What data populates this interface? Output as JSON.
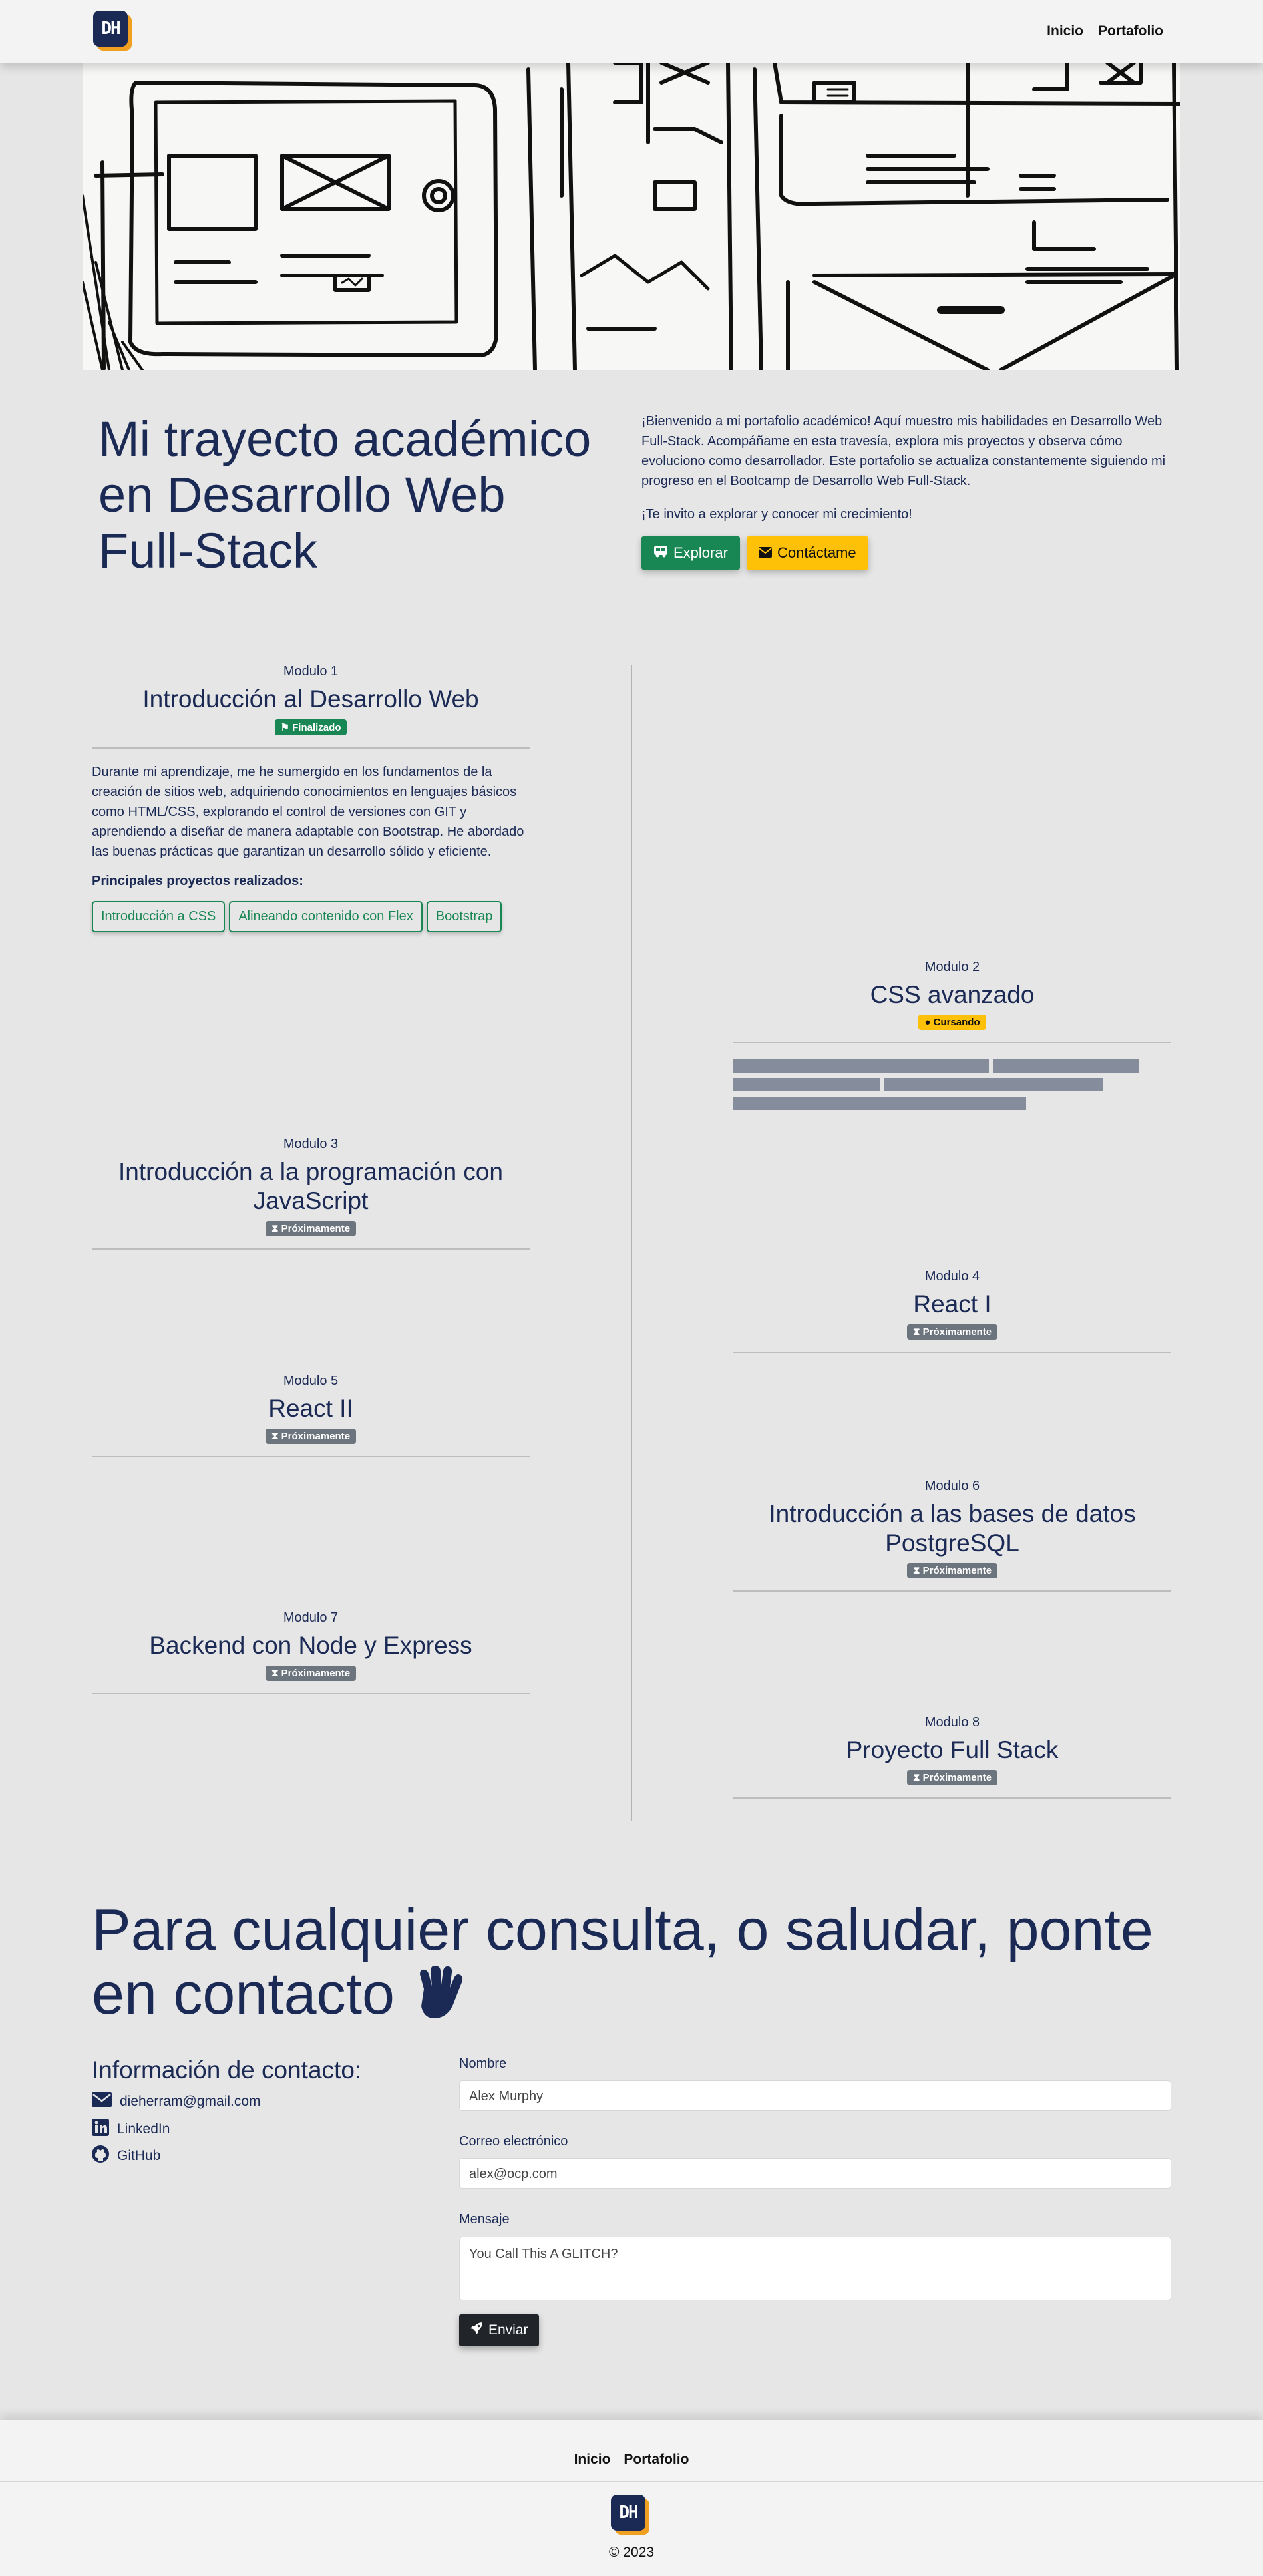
{
  "brand": {
    "logo_text": "DH"
  },
  "nav": {
    "items": [
      "Inicio",
      "Portafolio"
    ]
  },
  "intro": {
    "title": "Mi trayecto académico en Desarrollo Web Full-Stack",
    "paragraph1": "¡Bienvenido a mi portafolio académico! Aquí muestro mis habilidades en Desarrollo Web Full-Stack. Acompáñame en esta travesía, explora mis proyectos y observa cómo evoluciono como desarrollador. Este portafolio se actualiza constantemente siguiendo mi progreso en el Bootcamp de Desarrollo Web Full-Stack.",
    "paragraph2": "¡Te invito a explorar y conocer mi crecimiento!",
    "explore_label": "Explorar",
    "contact_label": "Contáctame"
  },
  "modules": [
    {
      "number_label": "Modulo 1",
      "title": "Introducción al Desarrollo Web",
      "status": "Finalizado",
      "description": "Durante mi aprendizaje, me he sumergido en los fundamentos de la creación de sitios web, adquiriendo conocimientos en lenguajes básicos como HTML/CSS, explorando el control de versiones con GIT y aprendiendo a diseñar de manera adaptable con Bootstrap. He abordado las buenas prácticas que garantizan un desarrollo sólido y eficiente.",
      "projects_heading": "Principales proyectos realizados:",
      "projects": [
        "Introducción a CSS",
        "Alineando contenido con Flex",
        "Bootstrap"
      ]
    },
    {
      "number_label": "Modulo 2",
      "title": "CSS avanzado",
      "status": "Cursando"
    },
    {
      "number_label": "Modulo 3",
      "title": "Introducción a la programación con JavaScript",
      "status": "Próximamente"
    },
    {
      "number_label": "Modulo 4",
      "title": "React I",
      "status": "Próximamente"
    },
    {
      "number_label": "Modulo 5",
      "title": "React II",
      "status": "Próximamente"
    },
    {
      "number_label": "Modulo 6",
      "title": "Introducción a las bases de datos PostgreSQL",
      "status": "Próximamente"
    },
    {
      "number_label": "Modulo 7",
      "title": "Backend con Node y Express",
      "status": "Próximamente"
    },
    {
      "number_label": "Modulo 8",
      "title": "Proyecto Full Stack",
      "status": "Próximamente"
    }
  ],
  "contact": {
    "title": "Para cualquier consulta, o saludar, ponte en contacto",
    "info_title": "Información de contacto:",
    "email": "dieherram@gmail.com",
    "linkedin": "LinkedIn",
    "github": "GitHub",
    "form": {
      "name_label": "Nombre",
      "name_placeholder": "Alex Murphy",
      "email_label": "Correo electrónico",
      "email_placeholder": "alex@ocp.com",
      "message_label": "Mensaje",
      "message_placeholder": "You Call This A GLITCH?",
      "submit_label": "Enviar"
    }
  },
  "footer": {
    "links": [
      "Inicio",
      "Portafolio"
    ],
    "copyright": "© 2023"
  },
  "colors": {
    "navy": "#1b2a55",
    "green": "#198754",
    "yellow": "#ffc107",
    "gray": "#6c757d",
    "logo_accent": "#f0a020"
  }
}
